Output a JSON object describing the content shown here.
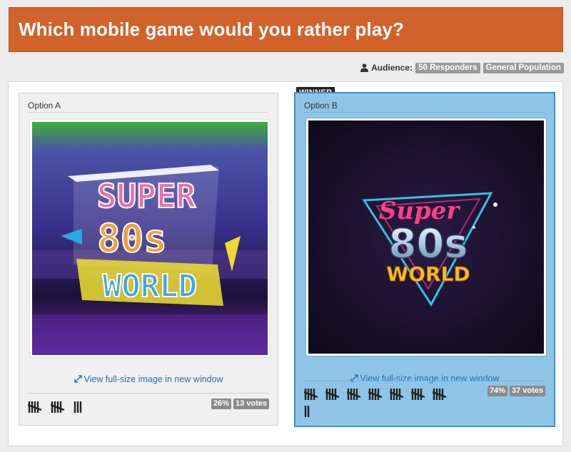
{
  "header": {
    "title": "Which mobile game would you rather play?"
  },
  "audience": {
    "label": "Audience:",
    "responders": "50 Responders",
    "population": "General Population",
    "icon": "user-icon"
  },
  "winner_tag": "WINNER",
  "options": [
    {
      "label": "Option A",
      "image_text": [
        "SUPER",
        "80s",
        "WORLD"
      ],
      "link_text": "View full-size image in new window",
      "percent": "26%",
      "votes": "13 votes",
      "vote_count": 13,
      "winner": false
    },
    {
      "label": "Option B",
      "image_text": [
        "Super",
        "80s",
        "WORLD"
      ],
      "link_text": "View full-size image in new window",
      "percent": "74%",
      "votes": "37 votes",
      "vote_count": 37,
      "winner": true
    }
  ],
  "colors": {
    "header_bg": "#d2622b",
    "winner_bg": "#8ec5e6",
    "winner_border": "#3a8fd0",
    "link": "#2a6fb8",
    "badge": "#9a9a9a"
  }
}
